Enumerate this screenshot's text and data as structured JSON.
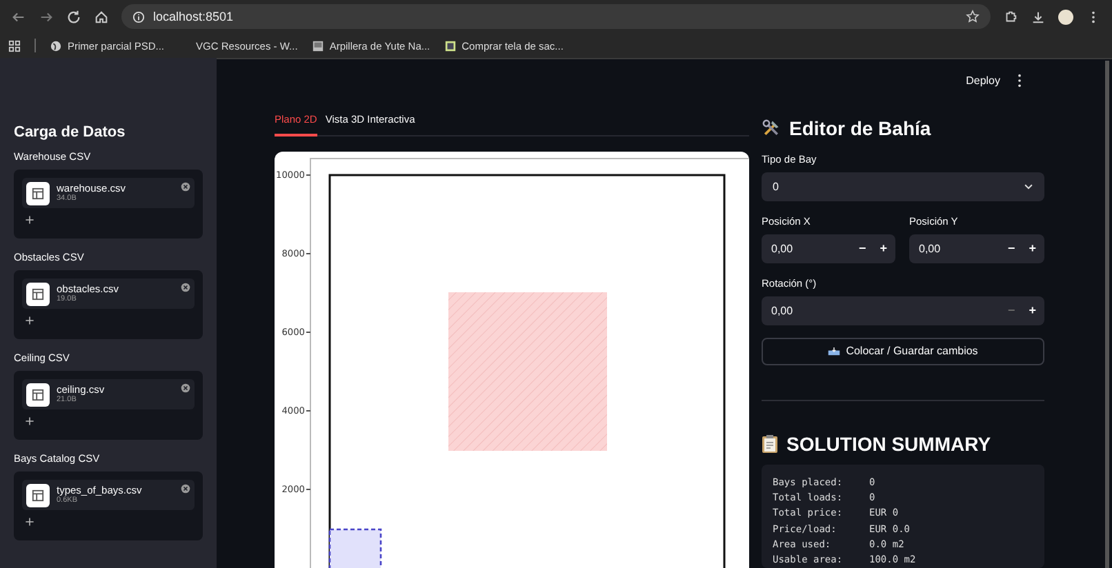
{
  "browser": {
    "url": "localhost:8501",
    "bookmarks": [
      {
        "label": "Primer parcial PSD...",
        "kind": "globe"
      },
      {
        "label": "VGC Resources - W...",
        "kind": "blank"
      },
      {
        "label": "Arpillera de Yute Na...",
        "kind": "image"
      },
      {
        "label": "Comprar tela de sac...",
        "kind": "square"
      }
    ]
  },
  "header": {
    "deploy": "Deploy"
  },
  "sidebar": {
    "title": "Carga de Datos",
    "uploads": [
      {
        "label": "Warehouse CSV",
        "file": "warehouse.csv",
        "size": "34.0B"
      },
      {
        "label": "Obstacles CSV",
        "file": "obstacles.csv",
        "size": "19.0B"
      },
      {
        "label": "Ceiling CSV",
        "file": "ceiling.csv",
        "size": "21.0B"
      },
      {
        "label": "Bays Catalog CSV",
        "file": "types_of_bays.csv",
        "size": "0.6KB"
      }
    ]
  },
  "tabs": [
    {
      "label": "Plano 2D",
      "selected": true
    },
    {
      "label": "Vista 3D Interactiva",
      "selected": false
    }
  ],
  "plot": {
    "yticks": [
      "10000",
      "8000",
      "6000",
      "4000",
      "2000"
    ]
  },
  "editor": {
    "title": "Editor de Bahía",
    "type_label": "Tipo de Bay",
    "type_value": "0",
    "fields": [
      {
        "label": "Posición X",
        "value": "0,00",
        "minus_disabled": false
      },
      {
        "label": "Posición Y",
        "value": "0,00",
        "minus_disabled": false
      },
      {
        "label": "Rotación (°)",
        "value": "0,00",
        "minus_disabled": true
      }
    ],
    "minus": "−",
    "plus": "+",
    "button": "Colocar / Guardar cambios"
  },
  "summary": {
    "title": "SOLUTION SUMMARY",
    "rows": [
      {
        "label": "Bays placed:",
        "value": "0"
      },
      {
        "label": "Total loads:",
        "value": "0"
      },
      {
        "label": "Total price:",
        "value": "EUR 0"
      },
      {
        "label": "Price/load:",
        "value": "EUR 0.0"
      },
      {
        "label": "Area used:",
        "value": "0.0 m2"
      },
      {
        "label": "Usable area:",
        "value": "100.0 m2"
      }
    ]
  }
}
